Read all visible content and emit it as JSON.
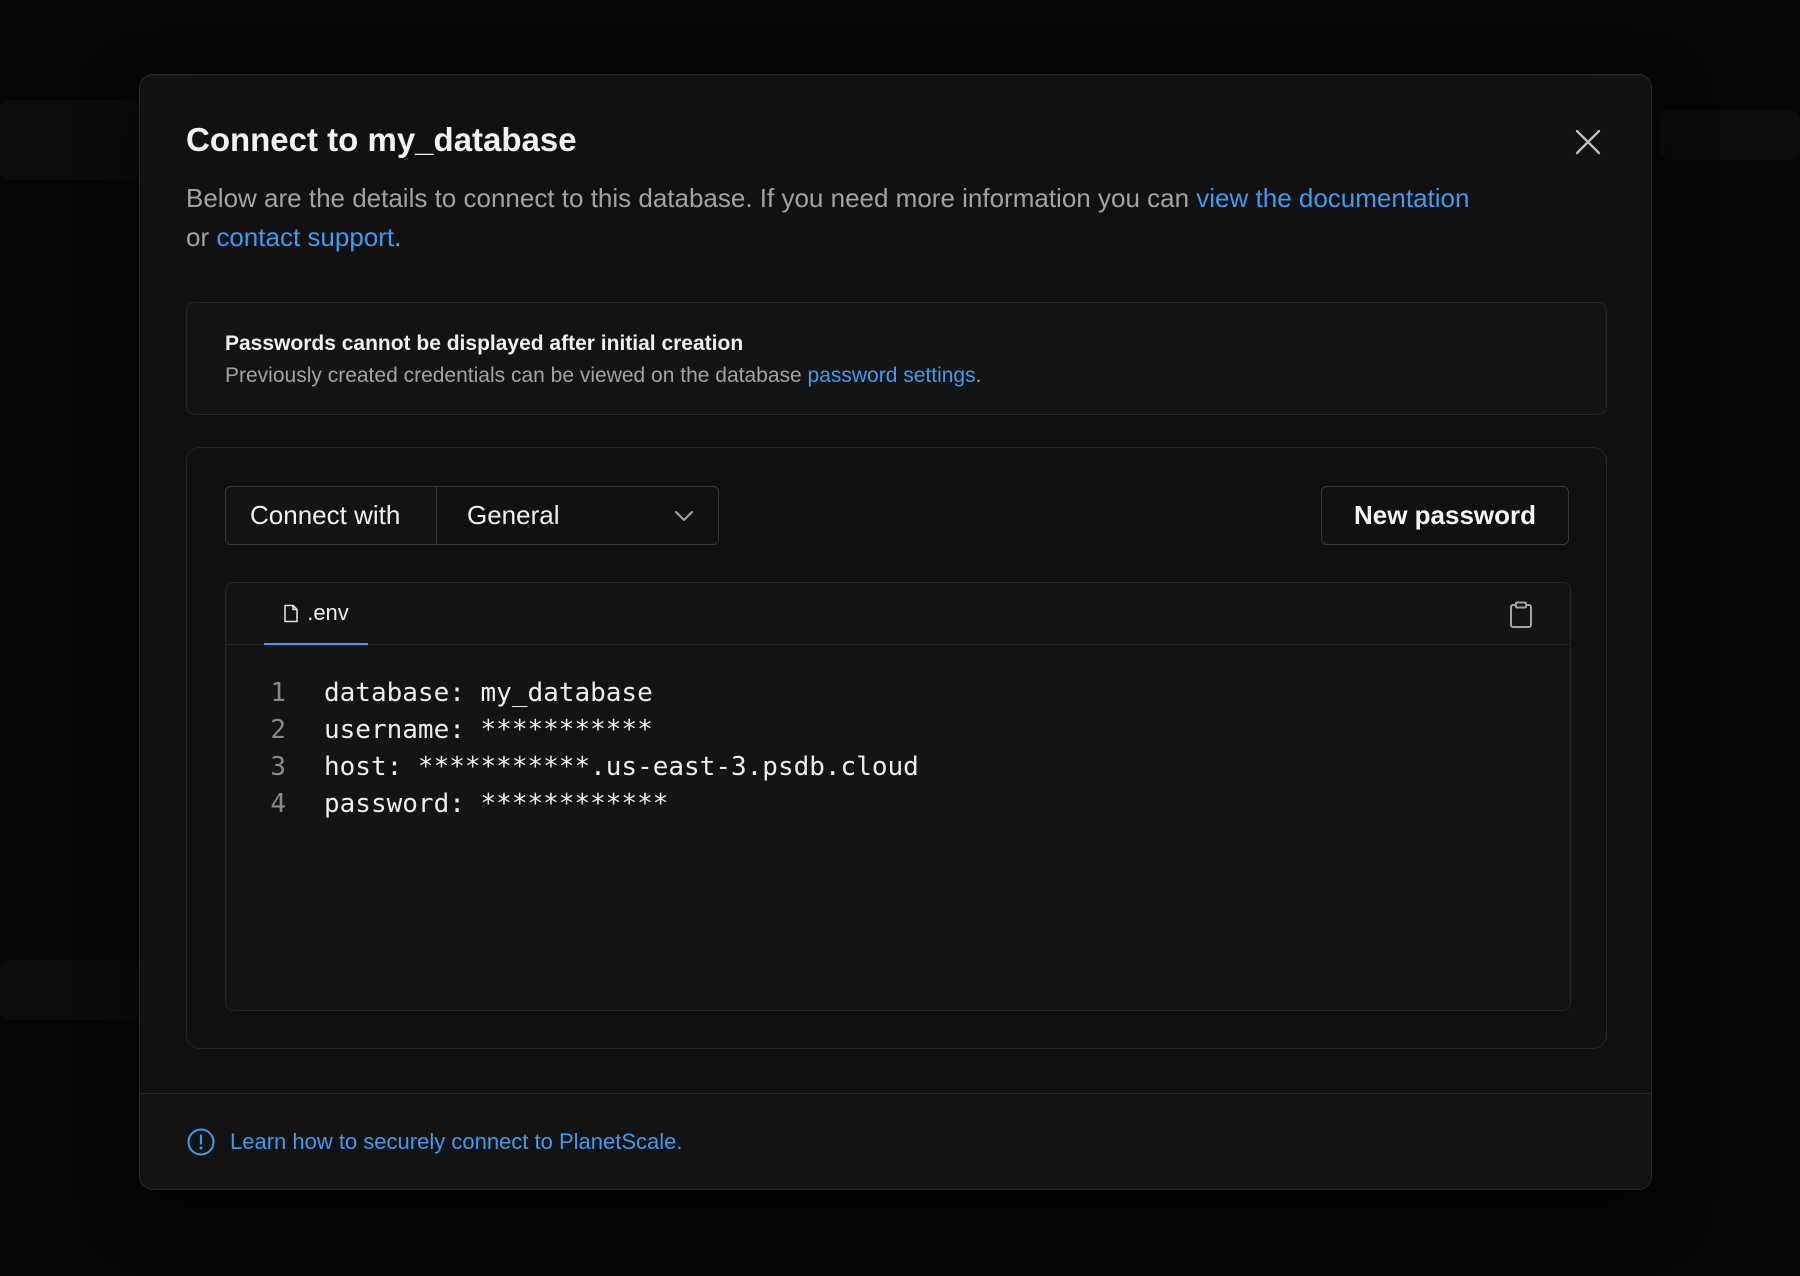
{
  "modal": {
    "title": "Connect to my_database",
    "subtitle_text": "Below are the details to connect to this database. If you need more information you can ",
    "subtitle_link_docs": "view the documentation",
    "subtitle_or": " or ",
    "subtitle_link_support": "contact support",
    "subtitle_end": "."
  },
  "notice": {
    "title": "Passwords cannot be displayed after initial creation",
    "text": "Previously created credentials can be viewed on the database ",
    "link": "password settings",
    "end": "."
  },
  "connect": {
    "label": "Connect with",
    "selected": "General"
  },
  "actions": {
    "new_password": "New password"
  },
  "editor": {
    "tab_label": ".env",
    "lines": [
      {
        "num": "1",
        "text": "database: my_database"
      },
      {
        "num": "2",
        "text": "username: ***********"
      },
      {
        "num": "3",
        "text": "host: ***********.us-east-3.psdb.cloud"
      },
      {
        "num": "4",
        "text": "password: ************"
      }
    ]
  },
  "footer": {
    "link": "Learn how to securely connect to PlanetScale."
  },
  "colors": {
    "accent": "#3d9bf0",
    "background": "#111111",
    "border": "#262626"
  }
}
